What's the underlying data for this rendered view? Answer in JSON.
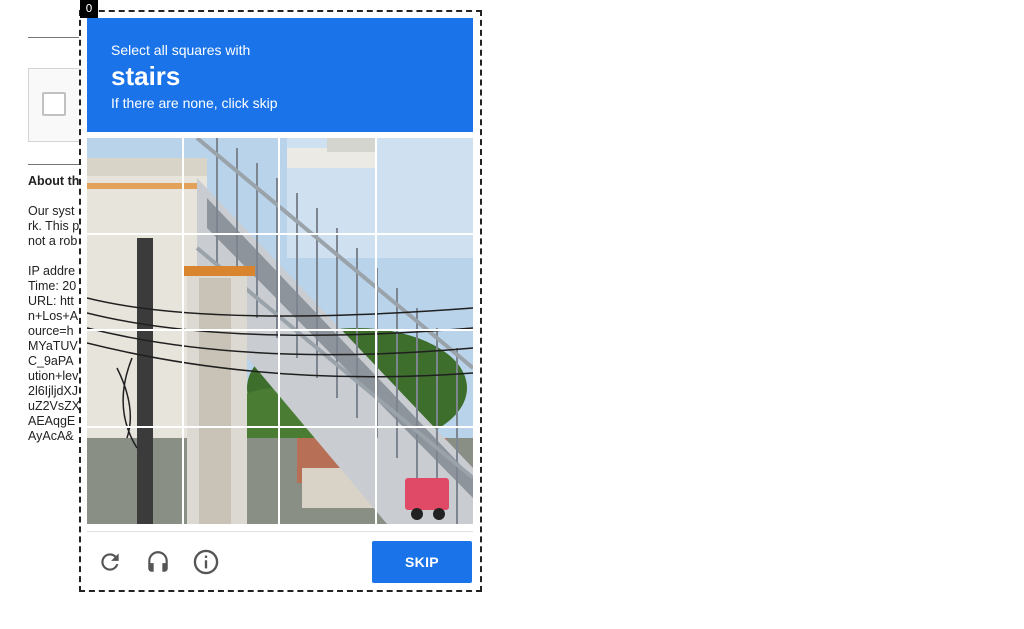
{
  "background_page": {
    "heading": "About th",
    "lines_a": [
      "Our syst",
      "rk. This p",
      "not a rob"
    ],
    "lines_b": [
      "IP addre",
      "Time: 20",
      "URL: htt",
      "n+Los+A",
      "ource=h",
      "MYaTUV",
      "C_9aPA",
      "ution+lev",
      "2l6IjljdXJ",
      "uZ2VsZX",
      "AEAqgE",
      "AyAcA&"
    ]
  },
  "challenge": {
    "index_badge": "0",
    "instruction_line1": "Select all squares with",
    "target_object": "stairs",
    "instruction_line3": "If there are none, click skip",
    "skip_label": "SKIP",
    "grid_rows": 4,
    "grid_cols": 4,
    "icons": {
      "reload": "reload-icon",
      "audio": "headphones-icon",
      "info": "info-icon"
    },
    "colors": {
      "accent": "#1a73e8",
      "icon_gray": "#555555"
    }
  }
}
